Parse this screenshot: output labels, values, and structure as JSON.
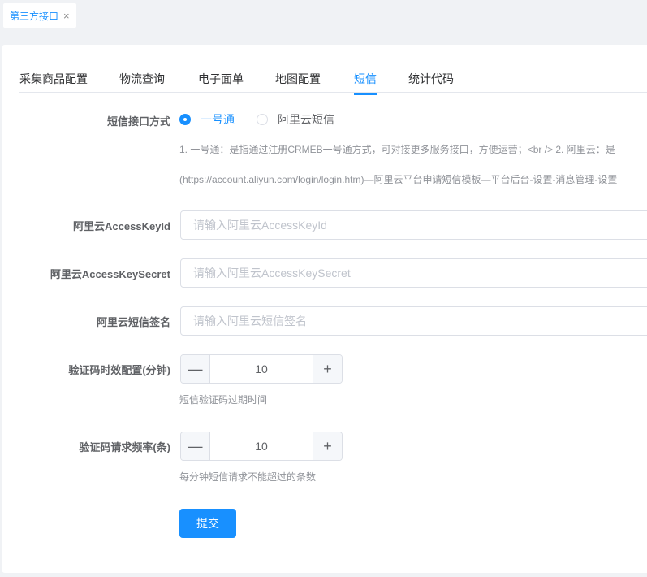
{
  "page_tab": {
    "label": "第三方接口",
    "close": "×"
  },
  "nav": {
    "items": [
      "采集商品配置",
      "物流查询",
      "电子面单",
      "地图配置",
      "短信",
      "统计代码"
    ],
    "active_index": 4
  },
  "form": {
    "sms_method": {
      "label": "短信接口方式",
      "options": [
        "一号通",
        "阿里云短信"
      ],
      "selected": "一号通",
      "tip_line1": "1. 一号通：是指通过注册CRMEB一号通方式，可对接更多服务接口，方便运营；<br /> 2. 阿里云：是",
      "tip_line2": "(https://account.aliyun.com/login/login.htm)—阿里云平台申请短信模板—平台后台-设置-消息管理-设置"
    },
    "access_key_id": {
      "label": "阿里云AccessKeyId",
      "value": "",
      "placeholder": "请输入阿里云AccessKeyId"
    },
    "access_key_secret": {
      "label": "阿里云AccessKeySecret",
      "value": "",
      "placeholder": "请输入阿里云AccessKeySecret"
    },
    "sign_name": {
      "label": "阿里云短信签名",
      "value": "",
      "placeholder": "请输入阿里云短信签名"
    },
    "code_expire": {
      "label": "验证码时效配置(分钟)",
      "value": "10",
      "tip": "短信验证码过期时间",
      "minus": "—",
      "plus": "+"
    },
    "code_rate": {
      "label": "验证码请求频率(条)",
      "value": "10",
      "tip": "每分钟短信请求不能超过的条数",
      "minus": "—",
      "plus": "+"
    },
    "submit_label": "提交"
  },
  "colors": {
    "primary": "#1890ff",
    "background": "#f0f2f5"
  }
}
